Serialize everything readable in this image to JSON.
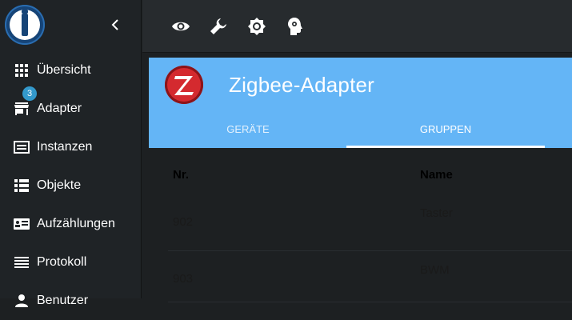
{
  "sidebar": {
    "collapse_icon": "chevron-left-icon",
    "items": [
      {
        "label": "Übersicht",
        "icon": "grid-icon"
      },
      {
        "label": "Adapter",
        "icon": "store-icon",
        "badge": "3"
      },
      {
        "label": "Instanzen",
        "icon": "instances-icon"
      },
      {
        "label": "Objekte",
        "icon": "list-icon"
      },
      {
        "label": "Aufzählungen",
        "icon": "enum-icon"
      },
      {
        "label": "Protokoll",
        "icon": "log-icon"
      },
      {
        "label": "Benutzer",
        "icon": "user-icon"
      }
    ]
  },
  "topbar": {
    "icons": [
      "eye-icon",
      "wrench-icon",
      "brightness-icon",
      "expert-head-icon"
    ]
  },
  "adapter": {
    "title": "Zigbee-Adapter",
    "tabs": [
      {
        "label": "Geräte",
        "active": false
      },
      {
        "label": "Gruppen",
        "active": true
      }
    ]
  },
  "table": {
    "headers": {
      "nr": "Nr.",
      "name": "Name"
    },
    "rows": [
      {
        "nr": "902",
        "name": "Taster"
      },
      {
        "nr": "903",
        "name": "BWM"
      }
    ]
  },
  "colors": {
    "sidebar_bg": "#1f2326",
    "header_bg": "#64b5f6",
    "badge": "#3399cc"
  }
}
